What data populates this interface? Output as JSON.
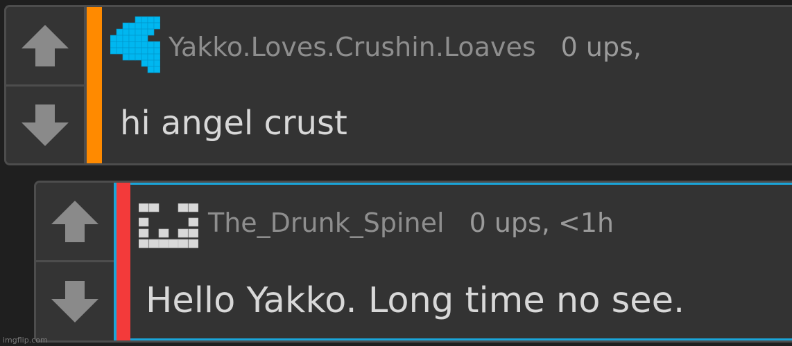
{
  "comments": [
    {
      "username": "Yakko.Loves.Crushin.Loaves",
      "stats": "0 ups,",
      "text": "hi angel crust",
      "depth_color": "#ff8a00",
      "avatar_color": "#00b7f0",
      "upvote_icon": "arrow-up-icon",
      "downvote_icon": "arrow-down-icon"
    },
    {
      "username": "The_Drunk_Spinel",
      "stats": "0 ups, <1h",
      "text": "Hello Yakko. Long time no see.",
      "depth_color": "#f33a3a",
      "highlight_color": "#1aa5d9",
      "avatar_color": "#d9d9d9",
      "upvote_icon": "arrow-up-icon",
      "downvote_icon": "arrow-down-icon"
    }
  ],
  "watermark": "imgflip.com"
}
